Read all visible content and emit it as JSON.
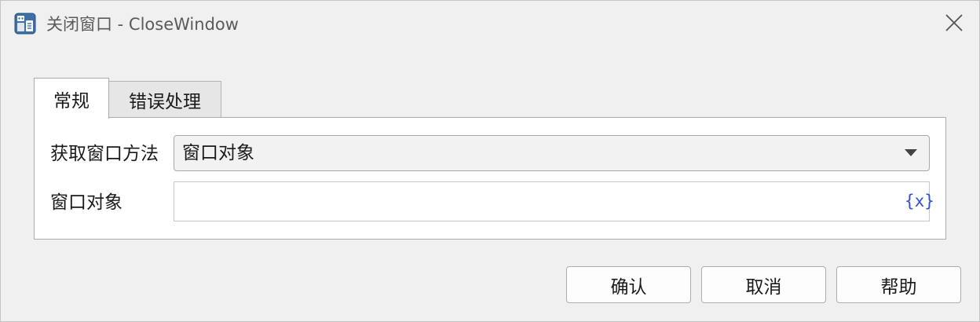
{
  "window": {
    "title": "关闭窗口 - CloseWindow"
  },
  "tabs": [
    {
      "label": "常规",
      "active": true
    },
    {
      "label": "错误处理",
      "active": false
    }
  ],
  "form": {
    "method_label": "获取窗口方法",
    "method_value": "窗口对象",
    "object_label": "窗口对象",
    "object_value": "",
    "variable_button": "{x}"
  },
  "buttons": {
    "ok": "确认",
    "cancel": "取消",
    "help": "帮助"
  },
  "icons": {
    "app": "robot-app-icon",
    "close": "close-icon",
    "dropdown": "chevron-down-icon"
  },
  "colors": {
    "variable_accent": "#2f4fd8",
    "window_bg": "#f0f0f0"
  }
}
